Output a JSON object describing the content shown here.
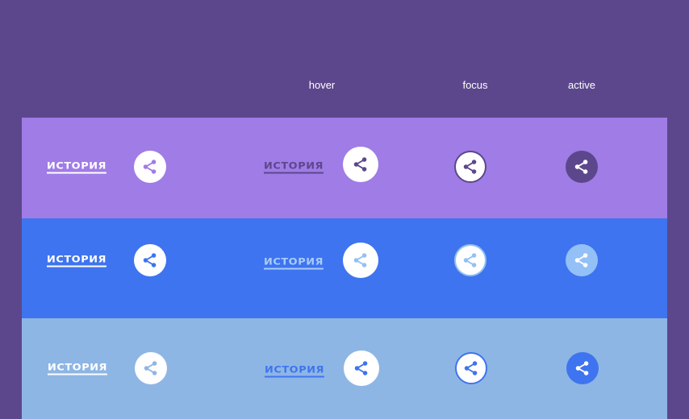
{
  "states": {
    "hover": "hover",
    "focus": "focus",
    "active": "active"
  },
  "rows": [
    {
      "link_label": "ИСТОРИЯ",
      "colors": {
        "band": "#a07ce6",
        "default_link": "#ffffff",
        "default_icon_bg": "#ffffff",
        "default_icon": "#a07ce6",
        "hover_link": "#5c478c",
        "hover_icon_bg": "#ffffff",
        "hover_icon": "#5c478c",
        "focus_icon_bg": "#ffffff",
        "focus_ring": "#5c478c",
        "focus_icon": "#5c478c",
        "active_icon_bg": "#5c478c",
        "active_icon": "#ffffff"
      }
    },
    {
      "link_label": "ИСТОРИЯ",
      "colors": {
        "band": "#3e74ef",
        "default_link": "#ffffff",
        "default_icon_bg": "#ffffff",
        "default_icon": "#3e74ef",
        "hover_link": "#a9cdfb",
        "hover_icon_bg": "#ffffff",
        "hover_icon": "#93c0f6",
        "focus_icon_bg": "#ffffff",
        "focus_ring": "#93c0f6",
        "focus_icon": "#93c0f6",
        "active_icon_bg": "#93c0f6",
        "active_icon": "#ffffff"
      }
    },
    {
      "link_label": "ИСТОРИЯ",
      "colors": {
        "band": "#8eb6e4",
        "default_link": "#ffffff",
        "default_icon_bg": "#ffffff",
        "default_icon": "#8eb6e4",
        "hover_link": "#3e74ef",
        "hover_icon_bg": "#ffffff",
        "hover_icon": "#3e74ef",
        "focus_icon_bg": "#ffffff",
        "focus_ring": "#3e74ef",
        "focus_icon": "#3e74ef",
        "active_icon_bg": "#3e74ef",
        "active_icon": "#ffffff"
      }
    }
  ],
  "icons": {
    "share": "share-icon"
  }
}
